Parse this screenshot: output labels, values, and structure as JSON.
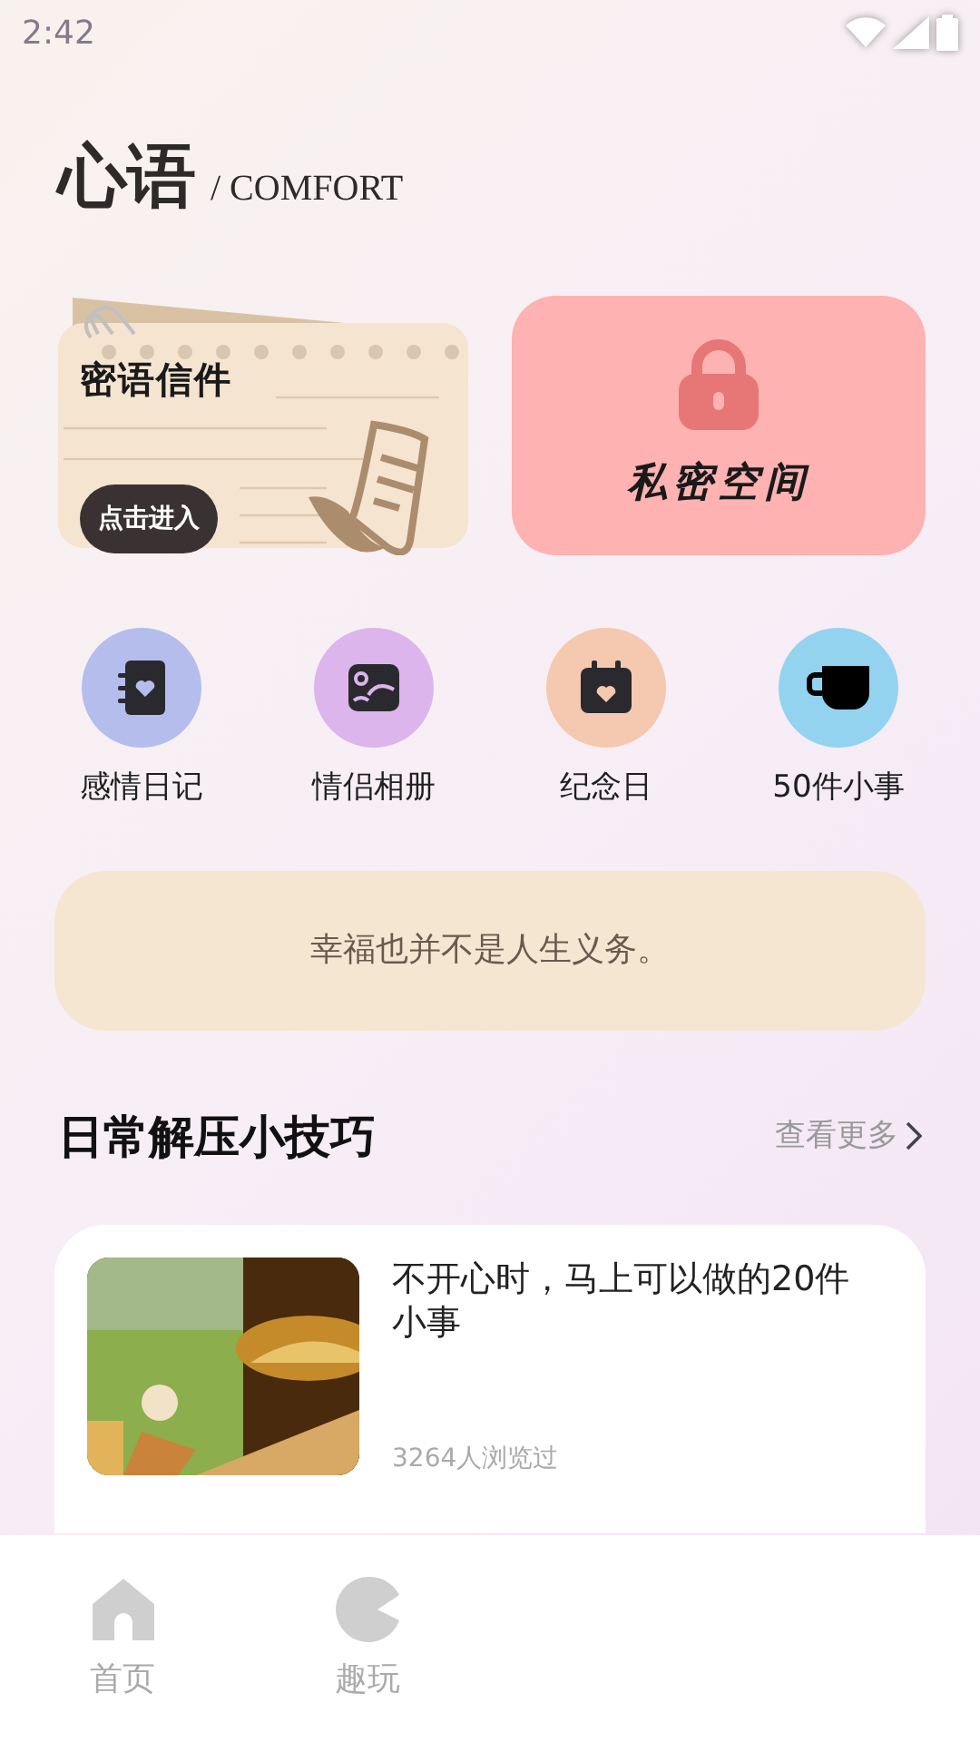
{
  "status_bar": {
    "time": "2:42"
  },
  "header": {
    "title": "心语",
    "subtitle": "/ COMFORT"
  },
  "feature_cards": [
    {
      "kind": "letter",
      "title": "密语信件",
      "button": "点击进入"
    },
    {
      "kind": "lock",
      "title": "私密空间"
    }
  ],
  "shortcuts": [
    {
      "kind": "diary",
      "label": "感情日记",
      "color": "#b4bdec"
    },
    {
      "kind": "album",
      "label": "情侣相册",
      "color": "#dcb5ec"
    },
    {
      "kind": "calendar",
      "label": "纪念日",
      "color": "#f5c8b0"
    },
    {
      "kind": "cup",
      "label": "50件小事",
      "color": "#93d3f0"
    }
  ],
  "quote": "幸福也并不是人生义务。",
  "section": {
    "title": "日常解压小技巧",
    "more": "查看更多"
  },
  "articles": [
    {
      "title": "不开心时，马上可以做的20件小事",
      "views": "3264人浏览过"
    }
  ],
  "bottom_nav": [
    {
      "kind": "home",
      "label": "首页"
    },
    {
      "kind": "play",
      "label": "趣玩"
    }
  ]
}
